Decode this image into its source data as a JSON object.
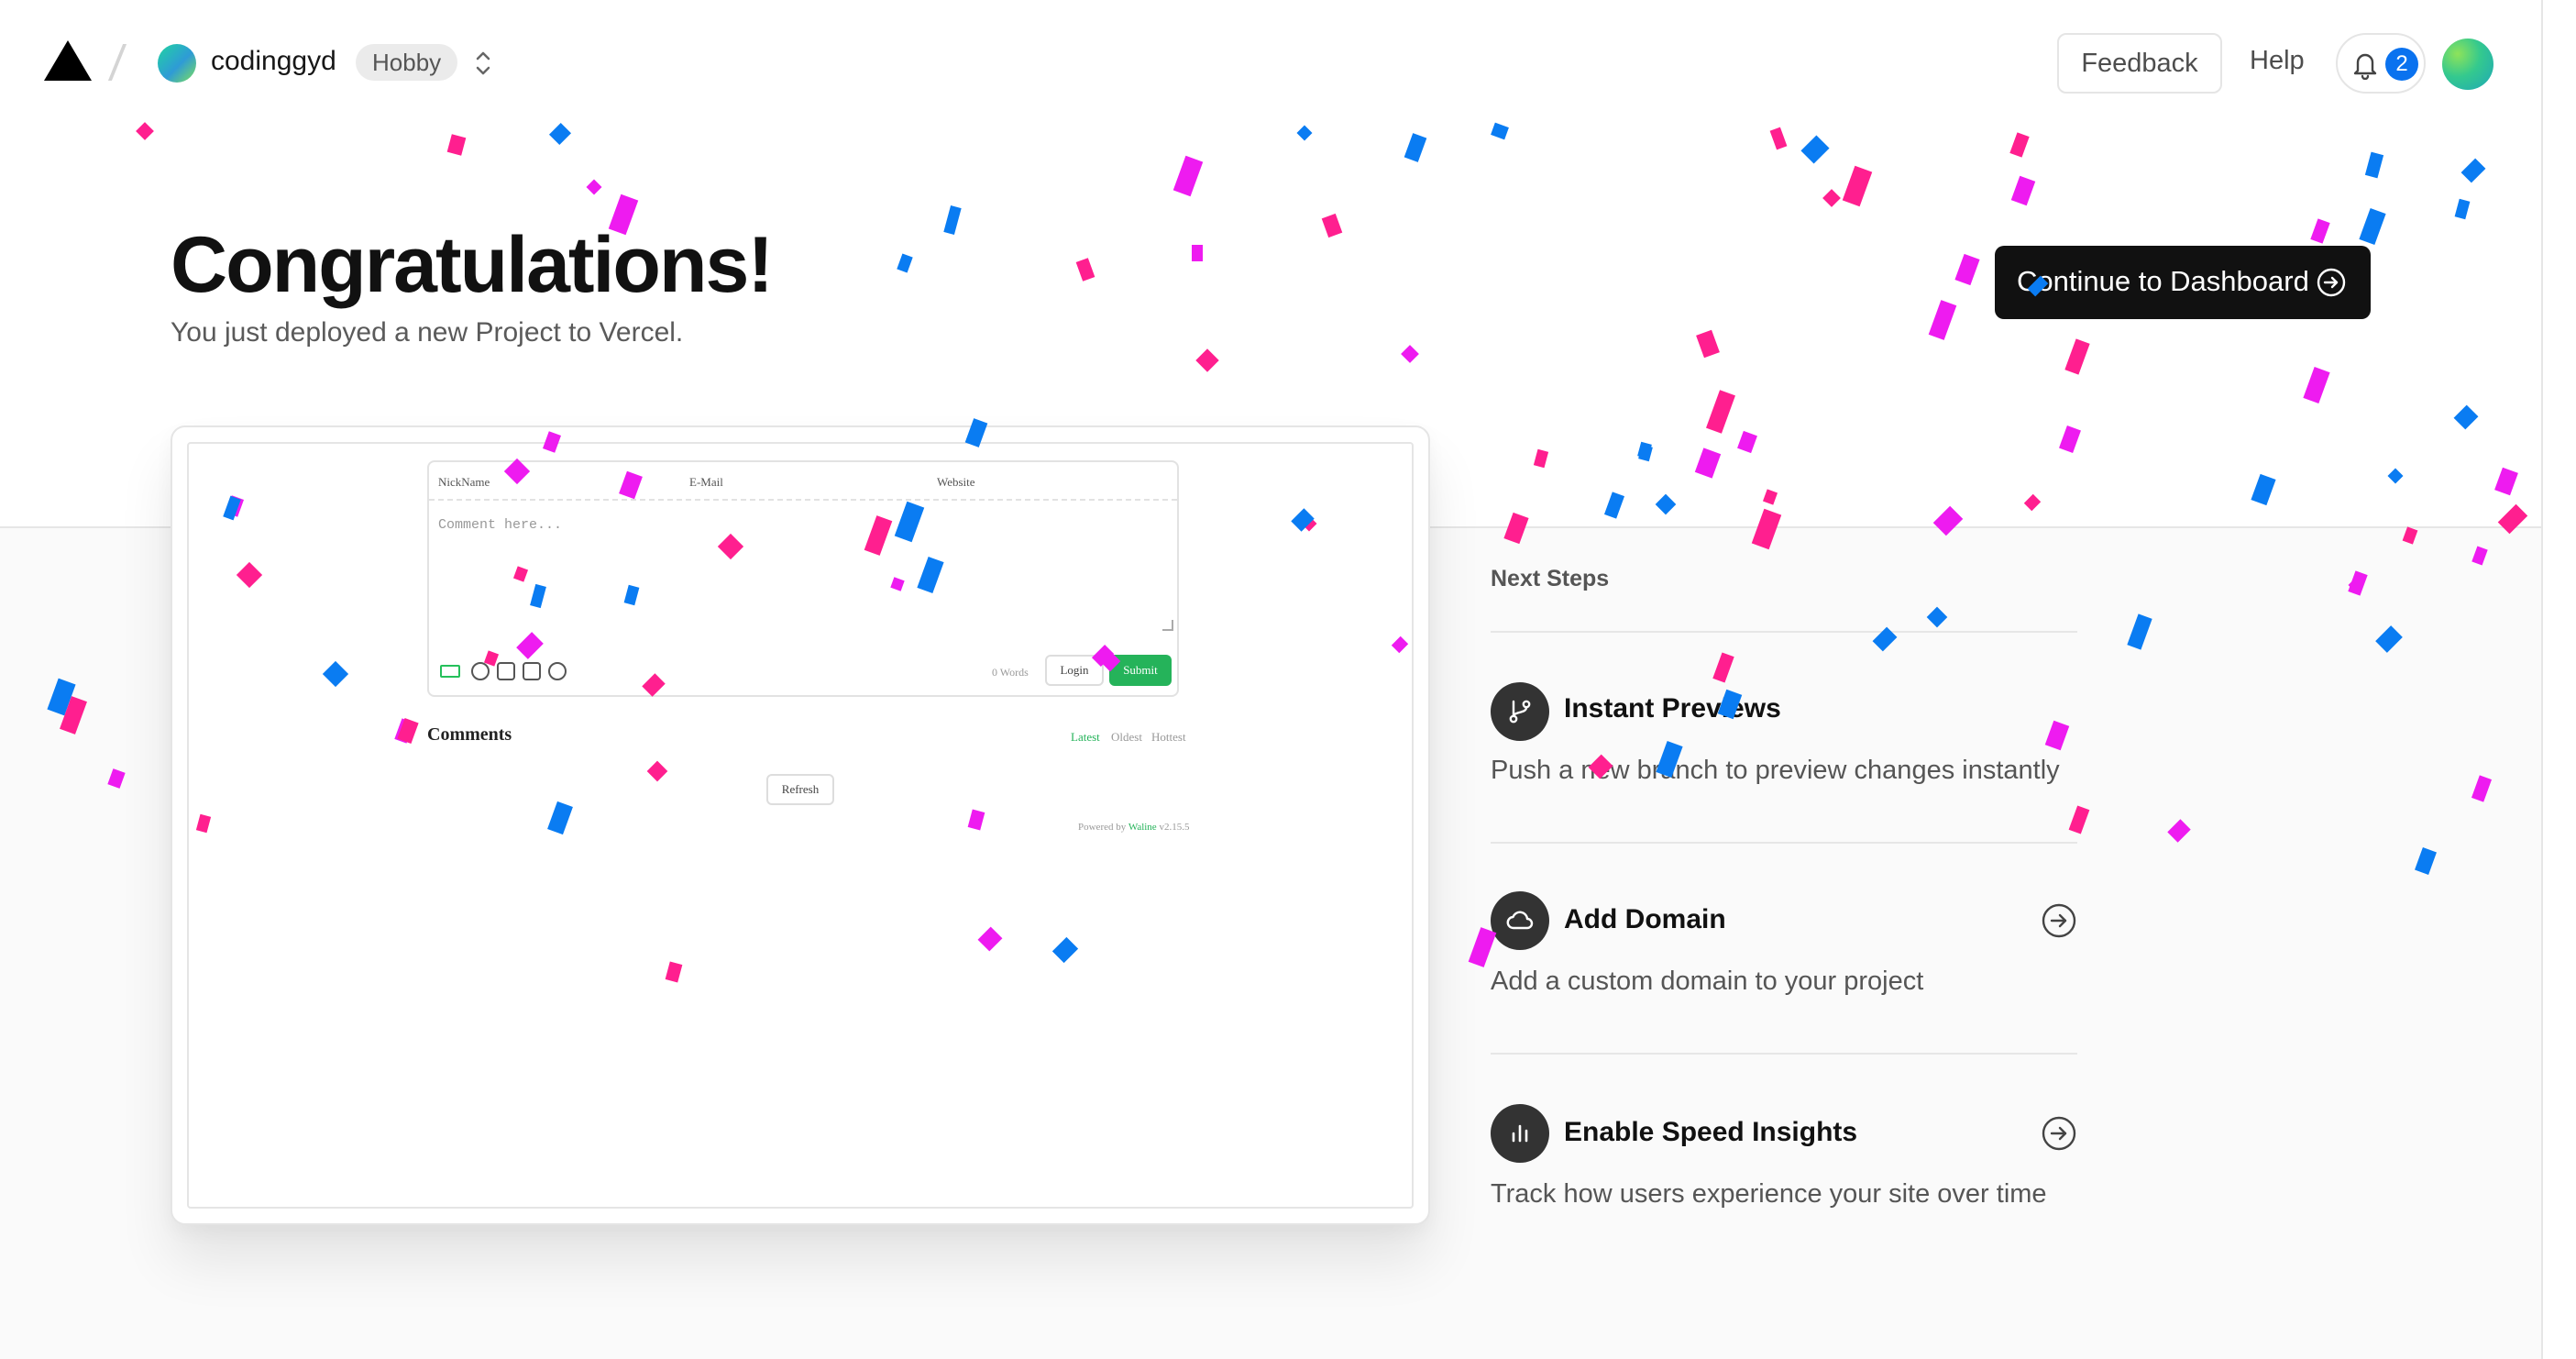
{
  "header": {
    "team_name": "codinggyd",
    "plan_badge": "Hobby",
    "feedback_label": "Feedback",
    "help_label": "Help",
    "notification_count": "2"
  },
  "hero": {
    "title": "Congratulations!",
    "subtitle": "You just deployed a new Project to Vercel.",
    "dashboard_button": "Continue to Dashboard"
  },
  "preview": {
    "nickname_label": "NickName",
    "email_label": "E-Mail",
    "website_label": "Website",
    "comment_placeholder": "Comment here...",
    "word_count": "0  Words",
    "login_label": "Login",
    "submit_label": "Submit",
    "comments_heading": "Comments",
    "sort_latest": "Latest",
    "sort_oldest": "Oldest",
    "sort_hottest": "Hottest",
    "refresh_label": "Refresh",
    "powered_by": "Powered by",
    "powered_name": "Waline",
    "powered_version": "v2.15.5"
  },
  "next_steps": {
    "heading": "Next Steps",
    "items": [
      {
        "title": "Instant Previews",
        "description": "Push a new branch to preview changes instantly",
        "icon": "git-branch-icon"
      },
      {
        "title": "Add Domain",
        "description": "Add a custom domain to your project",
        "icon": "cloud-icon"
      },
      {
        "title": "Enable Speed Insights",
        "description": "Track how users experience your site over time",
        "icon": "bar-chart-icon"
      }
    ]
  },
  "colors": {
    "confetti": [
      "#ff1f8f",
      "#ee1bf0",
      "#0a7cf2"
    ],
    "brand_dark": "#111111",
    "submit_green": "#25b35a",
    "badge_blue": "#0a72ef"
  }
}
